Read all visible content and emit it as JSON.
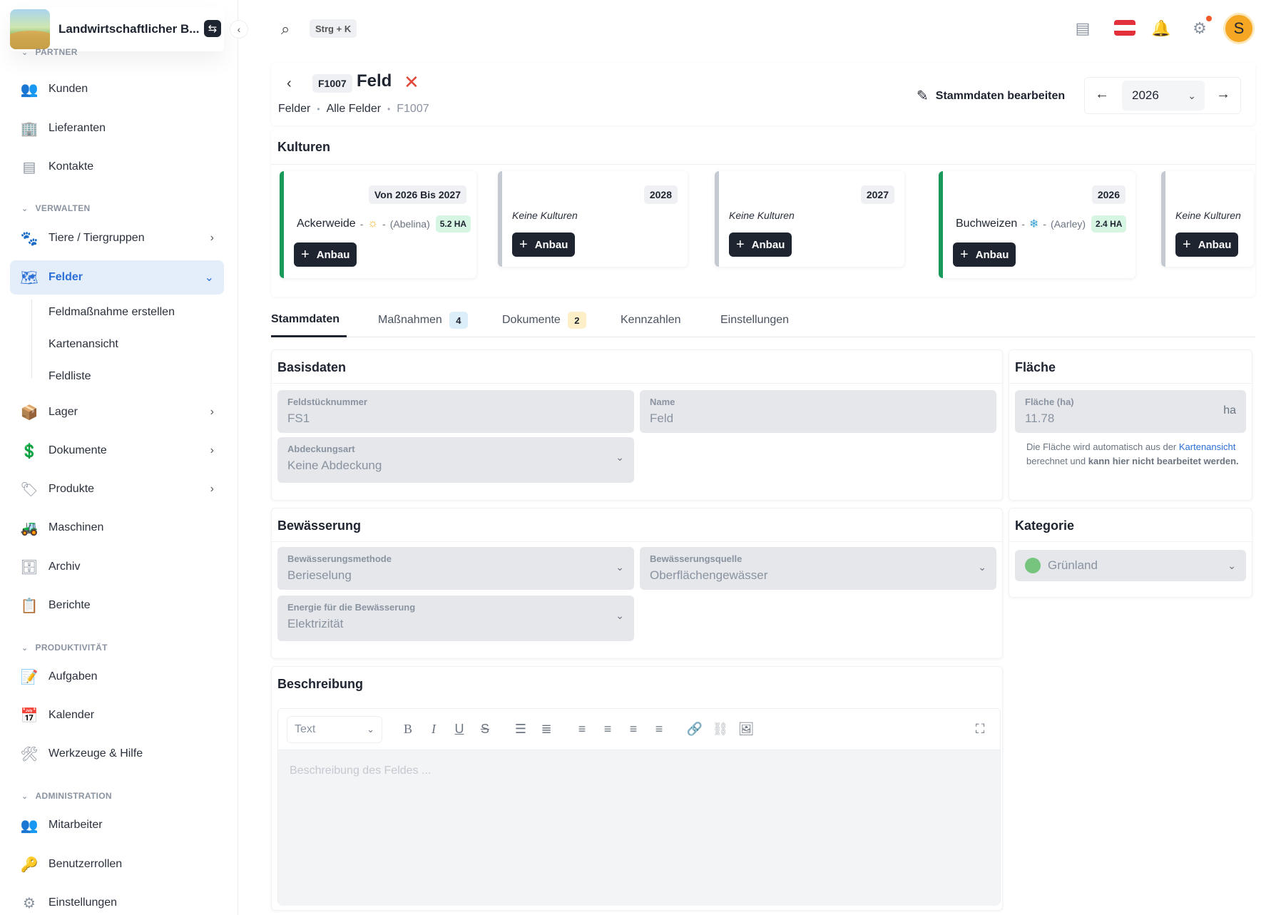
{
  "brand": {
    "name": "Landwirtschaftlicher B...",
    "switch_icon": "swap-icon"
  },
  "sidebar": {
    "sections": {
      "partner": "PARTNER",
      "verwalten": "VERWALTEN",
      "produktivitaet": "PRODUKTIVITÄT",
      "administration": "ADMINISTRATION"
    },
    "items": {
      "kunden": "Kunden",
      "lieferanten": "Lieferanten",
      "kontakte": "Kontakte",
      "tiere": "Tiere / Tiergruppen",
      "felder": "Felder",
      "feldmassnahme": "Feldmaßnahme erstellen",
      "kartenansicht": "Kartenansicht",
      "feldliste": "Feldliste",
      "lager": "Lager",
      "dokumente": "Dokumente",
      "produkte": "Produkte",
      "maschinen": "Maschinen",
      "archiv": "Archiv",
      "berichte": "Berichte",
      "aufgaben": "Aufgaben",
      "kalender": "Kalender",
      "werkzeuge": "Werkzeuge & Hilfe",
      "mitarbeiter": "Mitarbeiter",
      "benutzerrollen": "Benutzerrollen",
      "einstellungen": "Einstellungen"
    }
  },
  "topbar": {
    "shortcut": "Strg + K",
    "avatar_initial": "S",
    "accent": "#f5a623"
  },
  "header": {
    "id": "F1007",
    "title": "Feld",
    "breadcrumbs": [
      "Felder",
      "Alle Felder",
      "F1007"
    ],
    "edit_label": "Stammdaten bearbeiten",
    "year": "2026"
  },
  "kulturen": {
    "title": "Kulturen",
    "cards": [
      {
        "year": "Von 2026 Bis 2027",
        "crop": "Ackerweide",
        "variety": "(Abelina)",
        "symbol": "sun-icon",
        "ha": "5.2 HA",
        "button": "Anbau"
      },
      {
        "year": "2028",
        "none": "Keine Kulturen",
        "button": "Anbau"
      },
      {
        "year": "2027",
        "none": "Keine Kulturen",
        "button": "Anbau"
      },
      {
        "year": "2026",
        "crop": "Buchweizen",
        "variety": "(Aarley)",
        "symbol": "snowflake-icon",
        "ha": "2.4 HA",
        "button": "Anbau"
      },
      {
        "none": "Keine Kulturen",
        "button": "Anbau"
      }
    ]
  },
  "tabs": [
    {
      "label": "Stammdaten"
    },
    {
      "label": "Maßnahmen",
      "count": "4"
    },
    {
      "label": "Dokumente",
      "count": "2"
    },
    {
      "label": "Kennzahlen"
    },
    {
      "label": "Einstellungen"
    }
  ],
  "basisdaten": {
    "title": "Basisdaten",
    "feldstuecknummer": {
      "label": "Feldstücknummer",
      "value": "FS1"
    },
    "name": {
      "label": "Name",
      "value": "Feld"
    },
    "abdeckungsart": {
      "label": "Abdeckungsart",
      "value": "Keine Abdeckung"
    }
  },
  "flaeche": {
    "title": "Fläche",
    "label": "Fläche (ha)",
    "value": "11.78",
    "unit": "ha",
    "note_pre": "Die Fläche wird automatisch aus der ",
    "note_link": "Kartenansicht",
    "note_mid": " berechnet und ",
    "note_bold": "kann hier nicht bearbeitet werden."
  },
  "bewaesserung": {
    "title": "Bewässerung",
    "methode": {
      "label": "Bewässerungsmethode",
      "value": "Berieselung"
    },
    "quelle": {
      "label": "Bewässerungsquelle",
      "value": "Oberflächengewässer"
    },
    "energie": {
      "label": "Energie für die Bewässerung",
      "value": "Elektrizität"
    }
  },
  "kategorie": {
    "title": "Kategorie",
    "value": "Grünland",
    "color": "#76c47e"
  },
  "beschreibung": {
    "title": "Beschreibung",
    "format": "Text",
    "placeholder": "Beschreibung des Feldes ..."
  }
}
